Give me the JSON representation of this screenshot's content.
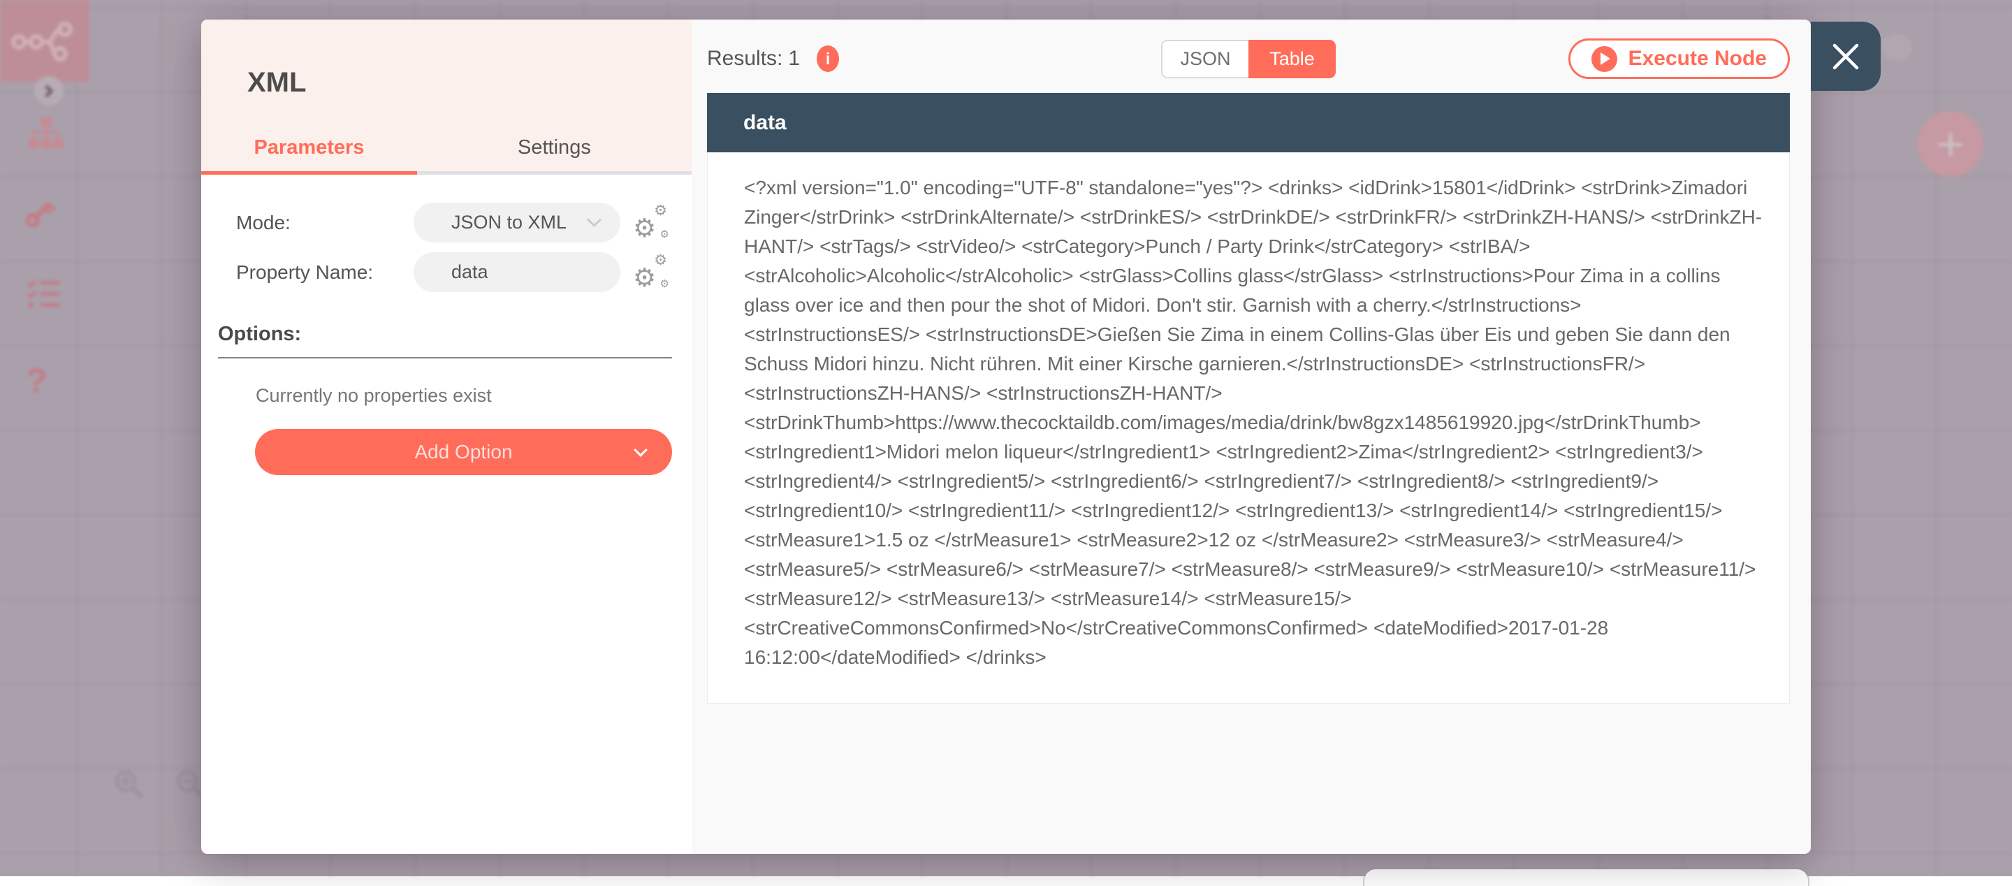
{
  "colors": {
    "accent": "#ff6d5a",
    "header_dark": "#3a4f60",
    "overlay": "#aaa0ab",
    "panel_header_bg": "#fcf0ec"
  },
  "icons": {
    "question": "?",
    "plus": "+",
    "info": "i",
    "gear": "⚙"
  },
  "node_panel": {
    "title": "XML",
    "tabs": [
      {
        "label": "Parameters",
        "active": true
      },
      {
        "label": "Settings",
        "active": false
      }
    ],
    "fields": [
      {
        "label": "Mode:",
        "value": "JSON to XML",
        "type": "select"
      },
      {
        "label": "Property Name:",
        "value": "data",
        "type": "text"
      }
    ],
    "options_heading": "Options:",
    "options_empty_text": "Currently no properties exist",
    "add_option_label": "Add Option"
  },
  "results_panel": {
    "results_label": "Results:",
    "results_count": "1",
    "view_toggle": [
      {
        "label": "JSON",
        "active": false
      },
      {
        "label": "Table",
        "active": true
      }
    ],
    "execute_button_label": "Execute Node",
    "table": {
      "header": "data",
      "content": "<?xml version=\"1.0\" encoding=\"UTF-8\" standalone=\"yes\"?> <drinks> <idDrink>15801</idDrink> <strDrink>Zimadori Zinger</strDrink> <strDrinkAlternate/> <strDrinkES/> <strDrinkDE/> <strDrinkFR/> <strDrinkZH-HANS/> <strDrinkZH-HANT/> <strTags/> <strVideo/> <strCategory>Punch / Party Drink</strCategory> <strIBA/> <strAlcoholic>Alcoholic</strAlcoholic> <strGlass>Collins glass</strGlass> <strInstructions>Pour Zima in a collins glass over ice and then pour the shot of Midori. Don't stir. Garnish with a cherry.</strInstructions> <strInstructionsES/> <strInstructionsDE>Gießen Sie Zima in einem Collins-Glas über Eis und geben Sie dann den Schuss Midori hinzu. Nicht rühren. Mit einer Kirsche garnieren.</strInstructionsDE> <strInstructionsFR/> <strInstructionsZH-HANS/> <strInstructionsZH-HANT/> <strDrinkThumb>https://www.thecocktaildb.com/images/media/drink/bw8gzx1485619920.jpg</strDrinkThumb> <strIngredient1>Midori melon liqueur</strIngredient1> <strIngredient2>Zima</strIngredient2> <strIngredient3/> <strIngredient4/> <strIngredient5/> <strIngredient6/> <strIngredient7/> <strIngredient8/> <strIngredient9/> <strIngredient10/> <strIngredient11/> <strIngredient12/> <strIngredient13/> <strIngredient14/> <strIngredient15/> <strMeasure1>1.5 oz </strMeasure1> <strMeasure2>12 oz </strMeasure2> <strMeasure3/> <strMeasure4/> <strMeasure5/> <strMeasure6/> <strMeasure7/> <strMeasure8/> <strMeasure9/> <strMeasure10/> <strMeasure11/> <strMeasure12/> <strMeasure13/> <strMeasure14/> <strMeasure15/> <strCreativeCommonsConfirmed>No</strCreativeCommonsConfirmed> <dateModified>2017-01-28 16:12:00</dateModified> </drinks>"
    }
  }
}
